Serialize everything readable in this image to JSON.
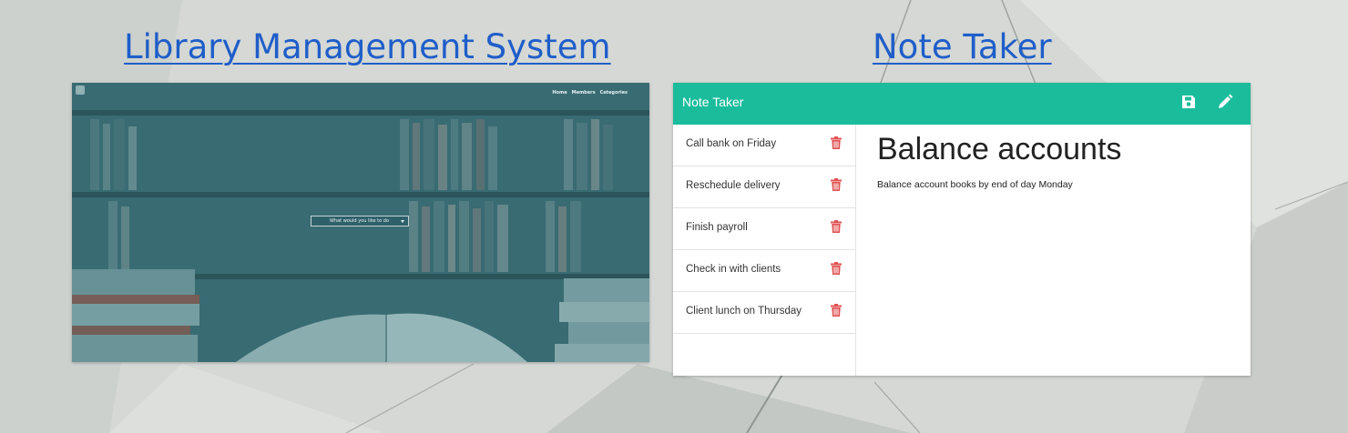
{
  "projects": [
    {
      "title": "Library Management System",
      "preview": {
        "nav": [
          "Home",
          "Members",
          "Categories"
        ],
        "select_placeholder": "What would you like to do"
      }
    },
    {
      "title": "Note Taker",
      "preview": {
        "app_title": "Note Taker",
        "header_icons": [
          "save-icon",
          "pencil-icon"
        ],
        "notes": [
          "Call bank on Friday",
          "Reschedule delivery",
          "Finish payroll",
          "Check in with clients",
          "Client lunch on Thursday"
        ],
        "active_note": {
          "title": "Balance accounts",
          "body": "Balance account books by end of day Monday"
        }
      }
    }
  ],
  "colors": {
    "link": "#1f5ec9",
    "note_header": "#1abc9c",
    "trash": "#e05252",
    "library_tint": "#35646b"
  }
}
